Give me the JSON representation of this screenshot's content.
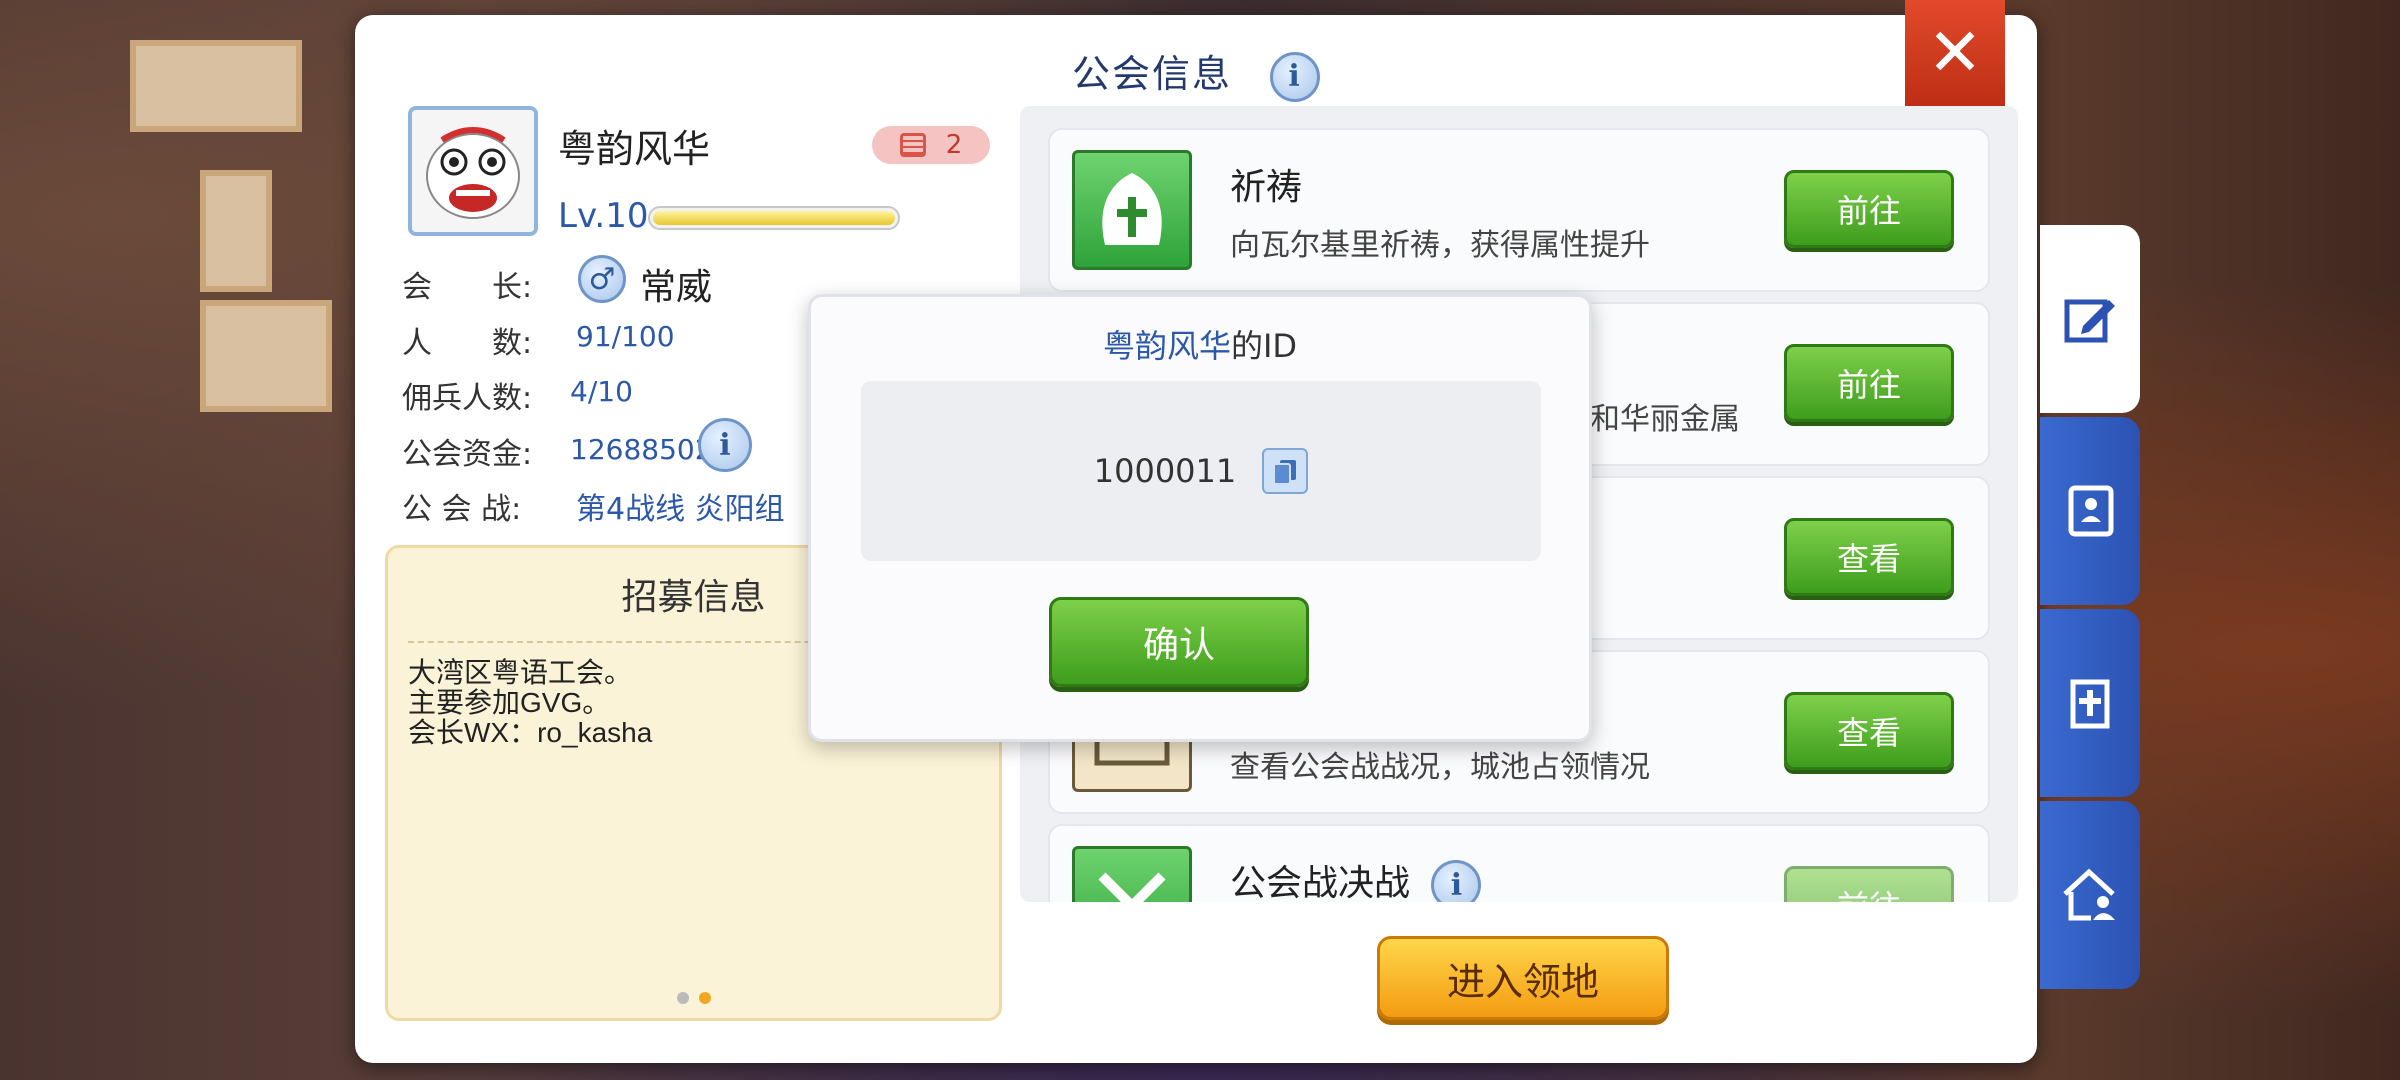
{
  "title": "公会信息",
  "close": "✕",
  "guild": {
    "name": "粤韵风华",
    "badge_count": "2",
    "level": "Lv.10",
    "level_progress": 1.0,
    "leader_label": "会　　长:",
    "leader_name": "常威",
    "members_label": "人　　数:",
    "members": "91/100",
    "mercs_label": "佣兵人数:",
    "mercs": "4/10",
    "funds_label": "公会资金:",
    "funds": "12688502",
    "war_label": "公 会 战:",
    "war": "第4战线  炎阳组"
  },
  "recruit": {
    "title": "招募信息",
    "lines": [
      "大湾区粤语工会。",
      "主要参加GVG。",
      "会长WX：ro_kasha"
    ]
  },
  "items": [
    {
      "title": "祈祷",
      "desc": "向瓦尔基里祈祷，获得属性提升",
      "button": "前往",
      "icon": "prayer-icon"
    },
    {
      "title": "",
      "desc": "和华丽金属",
      "button": "前往",
      "icon": ""
    },
    {
      "title": "",
      "desc": "",
      "button": "查看",
      "icon": ""
    },
    {
      "title": "",
      "desc": "查看公会战战况，城池占领情况",
      "button": "查看",
      "icon": "war-map-icon"
    },
    {
      "title": "公会战决战",
      "desc": "",
      "button": "前往",
      "icon": "crossed-swords-icon"
    }
  ],
  "enter_button": "进入领地",
  "dialog": {
    "name": "粤韵风华",
    "suffix": "的ID",
    "id": "1000011",
    "confirm": "确认"
  },
  "side_tabs": [
    "edit-icon",
    "contact-book-icon",
    "church-icon",
    "home-people-icon"
  ],
  "colors": {
    "accent_blue": "#2b58a8",
    "button_green": "#3e9d1c",
    "button_orange": "#f39c12",
    "close_red": "#c8321a"
  }
}
